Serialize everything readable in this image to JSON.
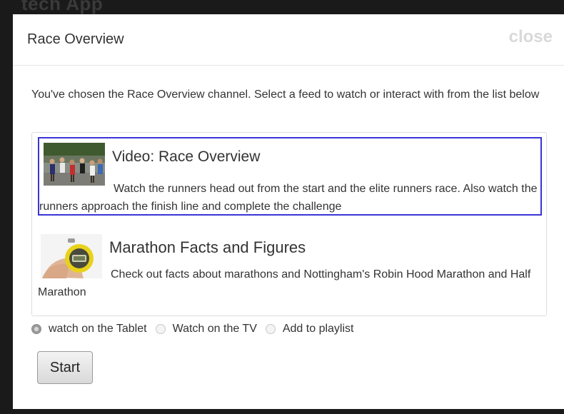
{
  "app": {
    "title": "tech App"
  },
  "modal": {
    "title": "Race Overview",
    "close_label": "close",
    "intro": "You've chosen the Race Overview channel. Select a feed to watch or interact with from the list below"
  },
  "feeds": [
    {
      "title": "Video: Race Overview",
      "description": "Watch the runners head out from the start and the elite runners race. Also watch the runners approach the finish line and complete the challenge",
      "thumbnail_icon": "runners-photo",
      "selected": true
    },
    {
      "title": "Marathon Facts and Figures",
      "description": "Check out facts about marathons and Nottingham's Robin Hood Marathon and Half Marathon",
      "thumbnail_icon": "stopwatch-photo",
      "selected": false
    }
  ],
  "watch_options": [
    {
      "label": "watch on the Tablet",
      "checked": true
    },
    {
      "label": "Watch on the TV",
      "checked": false
    },
    {
      "label": "Add to playlist",
      "checked": false
    }
  ],
  "start_label": "Start",
  "colors": {
    "selection_border": "#3a34d6",
    "close_text": "#d9d9d9"
  }
}
